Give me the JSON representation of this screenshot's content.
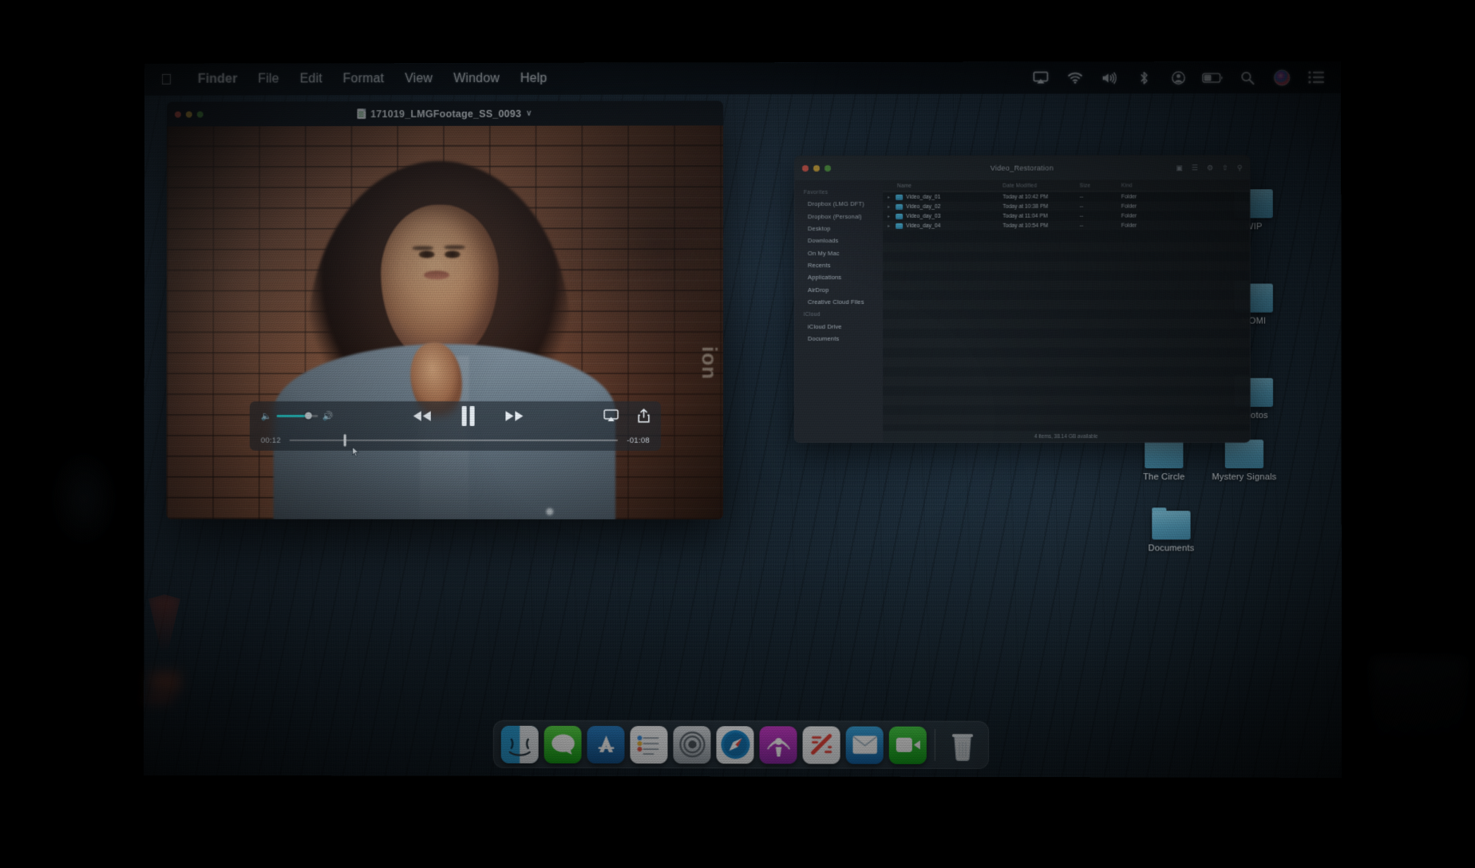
{
  "menubar": {
    "apple_glyph": "",
    "items": [
      {
        "label": "Finder",
        "bold": true
      },
      {
        "label": "File",
        "bold": false
      },
      {
        "label": "Edit",
        "bold": false
      },
      {
        "label": "Format",
        "bold": false
      },
      {
        "label": "View",
        "bold": false
      },
      {
        "label": "Window",
        "bold": false
      },
      {
        "label": "Help",
        "bold": false
      }
    ],
    "tray": [
      "airplay-icon",
      "wifi-icon",
      "volume-icon",
      "bluetooth-icon",
      "user-account-icon",
      "battery-icon",
      "search-icon",
      "siri-icon",
      "control-center-icon"
    ]
  },
  "player": {
    "title": "171019_LMGFootage_SS_0093",
    "title_chevron": "∨",
    "elapsed": "00:12",
    "remaining": "-01:08",
    "volume_percent": 78,
    "progress_percent": 17,
    "accent_color": "#27d3d3",
    "controls": [
      "volume-low-icon",
      "volume-slider",
      "volume-high-icon",
      "rewind-button",
      "pause-button",
      "fast-forward-button",
      "airplay-button",
      "share-button"
    ],
    "state": "playing",
    "wall_sign_text": "ion"
  },
  "finder": {
    "title": "Video_Restoration",
    "toolbar_icons": [
      "back-forward-icon",
      "view-options-icon",
      "arrange-icon",
      "action-icon",
      "share-icon",
      "tag-icon",
      "search-icon"
    ],
    "sidebar_sections": [
      {
        "header": "Favorites",
        "items": [
          "Dropbox (LMG DFT)",
          "Dropbox (Personal)",
          "Desktop",
          "Downloads",
          "On My Mac",
          "Recents",
          "Applications",
          "AirDrop",
          "Creative Cloud Files"
        ]
      },
      {
        "header": "iCloud",
        "items": [
          "iCloud Drive",
          "Documents"
        ]
      }
    ],
    "columns": [
      "Name",
      "Date Modified",
      "Size",
      "Kind"
    ],
    "rows": [
      {
        "name": "Video_day_01",
        "date": "Today at 10:42 PM",
        "size": "--",
        "kind": "Folder"
      },
      {
        "name": "Video_day_02",
        "date": "Today at 10:38 PM",
        "size": "--",
        "kind": "Folder"
      },
      {
        "name": "Video_day_03",
        "date": "Today at 11:04 PM",
        "size": "--",
        "kind": "Folder"
      },
      {
        "name": "Video_day_04",
        "date": "Today at 10:54 PM",
        "size": "--",
        "kind": "Folder"
      }
    ],
    "status": "4 items, 38.14 GB available"
  },
  "desktop": {
    "icons": [
      {
        "label": "WIP"
      },
      {
        "label": "MOMI"
      },
      {
        "label": "Photos"
      },
      {
        "label": "The Circle"
      },
      {
        "label": "Mystery Signals"
      },
      {
        "label": "Documents"
      }
    ]
  },
  "dock": {
    "items": [
      "finder-icon",
      "messages-icon",
      "app-store-icon",
      "reminders-icon",
      "system-preferences-icon",
      "safari-icon",
      "podcasts-icon",
      "news-icon",
      "mail-icon",
      "facetime-icon"
    ],
    "trash": "trash-icon"
  }
}
